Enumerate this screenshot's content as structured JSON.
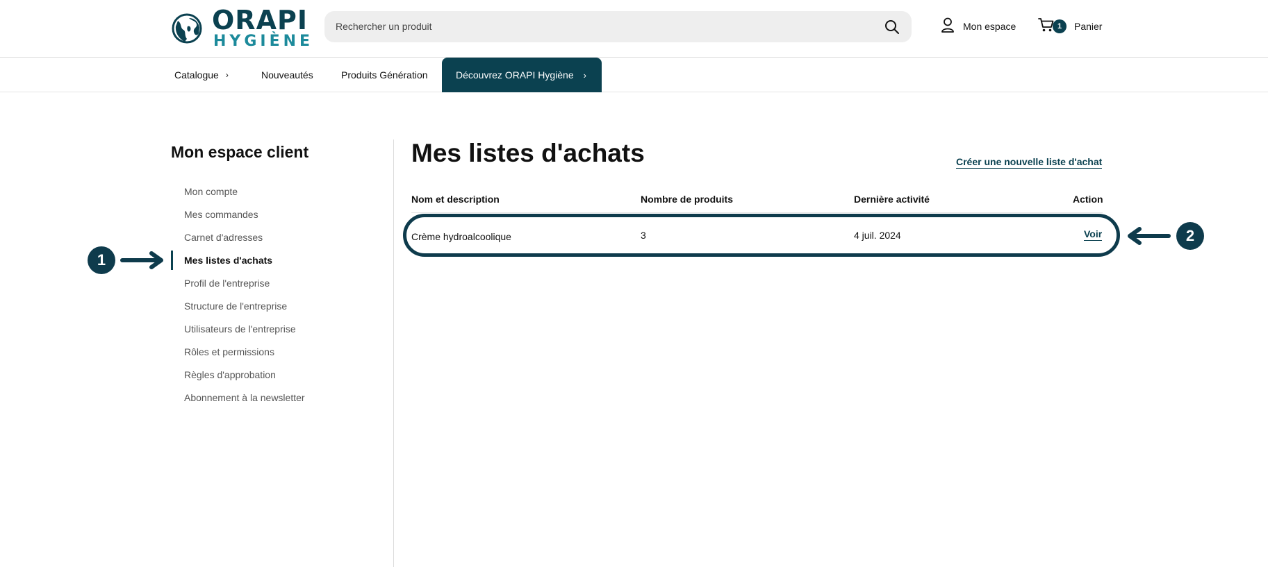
{
  "header": {
    "logo": {
      "line1": "ORAPI",
      "line2": "HYGIÈNE"
    },
    "search": {
      "placeholder": "Rechercher un produit"
    },
    "account_label": "Mon espace",
    "cart": {
      "count": "1",
      "label": "Panier"
    }
  },
  "nav": {
    "items": [
      {
        "label": "Catalogue"
      },
      {
        "label": "Nouveautés"
      },
      {
        "label": "Produits Génération"
      }
    ],
    "cta": "Découvrez ORAPI Hygiène"
  },
  "sidebar": {
    "title": "Mon espace client",
    "items": [
      {
        "label": "Mon compte"
      },
      {
        "label": "Mes commandes"
      },
      {
        "label": "Carnet d'adresses"
      },
      {
        "label": "Mes listes d'achats",
        "active": true
      },
      {
        "label": "Profil de l'entreprise"
      },
      {
        "label": "Structure de l'entreprise"
      },
      {
        "label": "Utilisateurs de l'entreprise"
      },
      {
        "label": "Rôles et permissions"
      },
      {
        "label": "Règles d'approbation"
      },
      {
        "label": "Abonnement à la newsletter"
      }
    ]
  },
  "main": {
    "title": "Mes listes d'achats",
    "create_link": "Créer une nouvelle liste d'achat",
    "columns": [
      "Nom et description",
      "Nombre de produits",
      "Dernière activité",
      "Action"
    ],
    "rows": [
      {
        "name": "Crème hydroalcoolique",
        "count": "3",
        "date": "4 juil. 2024",
        "action": "Voir"
      }
    ]
  },
  "annotations": {
    "marker1": "1",
    "marker2": "2"
  },
  "colors": {
    "brand": "#0b4150",
    "accent": "#1c8a9b",
    "annotation": "#0e3b4c"
  }
}
